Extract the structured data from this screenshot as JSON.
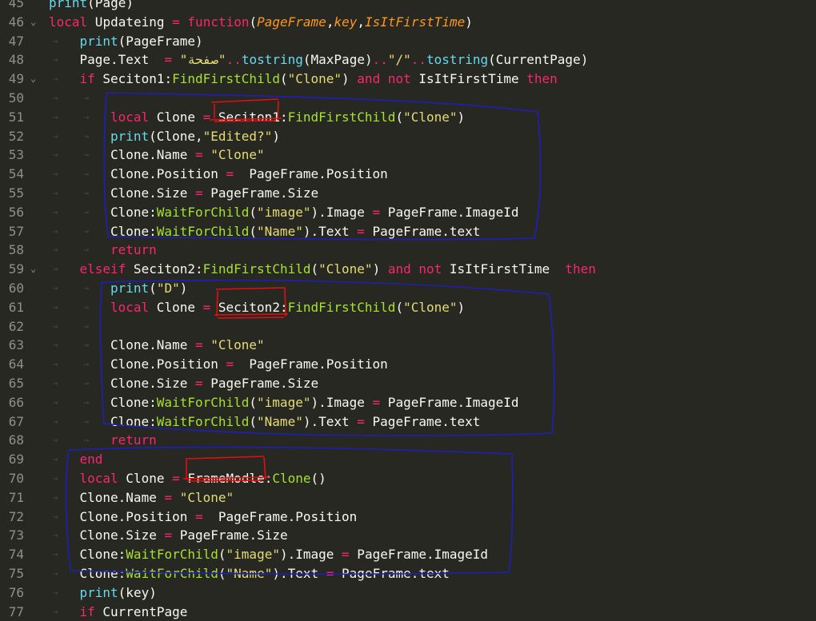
{
  "lines": [
    {
      "n": "45",
      "indent": 0,
      "fold": false,
      "tokens": [
        {
          "c": "bi",
          "t": "print"
        },
        {
          "c": "w",
          "t": "(Page)"
        }
      ]
    },
    {
      "n": "46",
      "indent": 0,
      "fold": true,
      "tokens": [
        {
          "c": "k",
          "t": "local"
        },
        {
          "c": "w",
          "t": " Updateing "
        },
        {
          "c": "k",
          "t": "="
        },
        {
          "c": "w",
          "t": " "
        },
        {
          "c": "k",
          "t": "function"
        },
        {
          "c": "w",
          "t": "("
        },
        {
          "c": "p",
          "t": "PageFrame"
        },
        {
          "c": "w",
          "t": ","
        },
        {
          "c": "p",
          "t": "key"
        },
        {
          "c": "w",
          "t": ","
        },
        {
          "c": "p",
          "t": "IsItFirstTime"
        },
        {
          "c": "w",
          "t": ")"
        }
      ]
    },
    {
      "n": "47",
      "indent": 1,
      "fold": false,
      "tokens": [
        {
          "c": "bi",
          "t": "print"
        },
        {
          "c": "w",
          "t": "(PageFrame)"
        }
      ]
    },
    {
      "n": "48",
      "indent": 1,
      "fold": false,
      "tokens": [
        {
          "c": "w",
          "t": "Page.Text  "
        },
        {
          "c": "k",
          "t": "="
        },
        {
          "c": "w",
          "t": " "
        },
        {
          "c": "s",
          "t": "\"صفحة\""
        },
        {
          "c": "k",
          "t": ".."
        },
        {
          "c": "bi",
          "t": "tostring"
        },
        {
          "c": "w",
          "t": "(MaxPage)"
        },
        {
          "c": "k",
          "t": ".."
        },
        {
          "c": "s",
          "t": "\"/\""
        },
        {
          "c": "k",
          "t": ".."
        },
        {
          "c": "bi",
          "t": "tostring"
        },
        {
          "c": "w",
          "t": "(CurrentPage)"
        }
      ]
    },
    {
      "n": "49",
      "indent": 1,
      "fold": true,
      "tokens": [
        {
          "c": "k",
          "t": "if"
        },
        {
          "c": "w",
          "t": " Seciton1:"
        },
        {
          "c": "f",
          "t": "FindFirstChild"
        },
        {
          "c": "w",
          "t": "("
        },
        {
          "c": "s",
          "t": "\"Clone\""
        },
        {
          "c": "w",
          "t": ") "
        },
        {
          "c": "k",
          "t": "and"
        },
        {
          "c": "w",
          "t": " "
        },
        {
          "c": "k",
          "t": "not"
        },
        {
          "c": "w",
          "t": " IsItFirstTime "
        },
        {
          "c": "k",
          "t": "then"
        }
      ]
    },
    {
      "n": "50",
      "indent": 2,
      "fold": false,
      "tokens": []
    },
    {
      "n": "51",
      "indent": 2,
      "fold": false,
      "tokens": [
        {
          "c": "k",
          "t": "local"
        },
        {
          "c": "w",
          "t": " Clone "
        },
        {
          "c": "k",
          "t": "="
        },
        {
          "c": "w",
          "t": " Seciton1:"
        },
        {
          "c": "f",
          "t": "FindFirstChild"
        },
        {
          "c": "w",
          "t": "("
        },
        {
          "c": "s",
          "t": "\"Clone\""
        },
        {
          "c": "w",
          "t": ")"
        }
      ]
    },
    {
      "n": "52",
      "indent": 2,
      "fold": false,
      "tokens": [
        {
          "c": "bi",
          "t": "print"
        },
        {
          "c": "w",
          "t": "(Clone,"
        },
        {
          "c": "s",
          "t": "\"Edited?\""
        },
        {
          "c": "w",
          "t": ")"
        }
      ]
    },
    {
      "n": "53",
      "indent": 2,
      "fold": false,
      "tokens": [
        {
          "c": "w",
          "t": "Clone.Name "
        },
        {
          "c": "k",
          "t": "="
        },
        {
          "c": "w",
          "t": " "
        },
        {
          "c": "s",
          "t": "\"Clone\""
        }
      ]
    },
    {
      "n": "54",
      "indent": 2,
      "fold": false,
      "tokens": [
        {
          "c": "w",
          "t": "Clone.Position "
        },
        {
          "c": "k",
          "t": "="
        },
        {
          "c": "w",
          "t": "  PageFrame.Position"
        }
      ]
    },
    {
      "n": "55",
      "indent": 2,
      "fold": false,
      "tokens": [
        {
          "c": "w",
          "t": "Clone.Size "
        },
        {
          "c": "k",
          "t": "="
        },
        {
          "c": "w",
          "t": " PageFrame.Size"
        }
      ]
    },
    {
      "n": "56",
      "indent": 2,
      "fold": false,
      "tokens": [
        {
          "c": "w",
          "t": "Clone:"
        },
        {
          "c": "f",
          "t": "WaitForChild"
        },
        {
          "c": "w",
          "t": "("
        },
        {
          "c": "s",
          "t": "\"image\""
        },
        {
          "c": "w",
          "t": ").Image "
        },
        {
          "c": "k",
          "t": "="
        },
        {
          "c": "w",
          "t": " PageFrame.ImageId"
        }
      ]
    },
    {
      "n": "57",
      "indent": 2,
      "fold": false,
      "tokens": [
        {
          "c": "w",
          "t": "Clone:"
        },
        {
          "c": "f",
          "t": "WaitForChild"
        },
        {
          "c": "w",
          "t": "("
        },
        {
          "c": "s",
          "t": "\"Name\""
        },
        {
          "c": "w",
          "t": ").Text "
        },
        {
          "c": "k",
          "t": "="
        },
        {
          "c": "w",
          "t": " PageFrame.text"
        }
      ]
    },
    {
      "n": "58",
      "indent": 2,
      "fold": false,
      "tokens": [
        {
          "c": "k",
          "t": "return"
        }
      ]
    },
    {
      "n": "59",
      "indent": 1,
      "fold": true,
      "tokens": [
        {
          "c": "k",
          "t": "elseif"
        },
        {
          "c": "w",
          "t": " Seciton2:"
        },
        {
          "c": "f",
          "t": "FindFirstChild"
        },
        {
          "c": "w",
          "t": "("
        },
        {
          "c": "s",
          "t": "\"Clone\""
        },
        {
          "c": "w",
          "t": ") "
        },
        {
          "c": "k",
          "t": "and"
        },
        {
          "c": "w",
          "t": " "
        },
        {
          "c": "k",
          "t": "not"
        },
        {
          "c": "w",
          "t": " IsItFirstTime  "
        },
        {
          "c": "k",
          "t": "then"
        }
      ]
    },
    {
      "n": "60",
      "indent": 2,
      "fold": false,
      "tokens": [
        {
          "c": "bi",
          "t": "print"
        },
        {
          "c": "w",
          "t": "("
        },
        {
          "c": "s",
          "t": "\"D\""
        },
        {
          "c": "w",
          "t": ")"
        }
      ]
    },
    {
      "n": "61",
      "indent": 2,
      "fold": false,
      "tokens": [
        {
          "c": "k",
          "t": "local"
        },
        {
          "c": "w",
          "t": " Clone "
        },
        {
          "c": "k",
          "t": "="
        },
        {
          "c": "w",
          "t": " Seciton2:"
        },
        {
          "c": "f",
          "t": "FindFirstChild"
        },
        {
          "c": "w",
          "t": "("
        },
        {
          "c": "s",
          "t": "\"Clone\""
        },
        {
          "c": "w",
          "t": ")"
        }
      ]
    },
    {
      "n": "62",
      "indent": 2,
      "fold": false,
      "tokens": []
    },
    {
      "n": "63",
      "indent": 2,
      "fold": false,
      "tokens": [
        {
          "c": "w",
          "t": "Clone.Name "
        },
        {
          "c": "k",
          "t": "="
        },
        {
          "c": "w",
          "t": " "
        },
        {
          "c": "s",
          "t": "\"Clone\""
        }
      ]
    },
    {
      "n": "64",
      "indent": 2,
      "fold": false,
      "tokens": [
        {
          "c": "w",
          "t": "Clone.Position "
        },
        {
          "c": "k",
          "t": "="
        },
        {
          "c": "w",
          "t": "  PageFrame.Position"
        }
      ]
    },
    {
      "n": "65",
      "indent": 2,
      "fold": false,
      "tokens": [
        {
          "c": "w",
          "t": "Clone.Size "
        },
        {
          "c": "k",
          "t": "="
        },
        {
          "c": "w",
          "t": " PageFrame.Size"
        }
      ]
    },
    {
      "n": "66",
      "indent": 2,
      "fold": false,
      "tokens": [
        {
          "c": "w",
          "t": "Clone:"
        },
        {
          "c": "f",
          "t": "WaitForChild"
        },
        {
          "c": "w",
          "t": "("
        },
        {
          "c": "s",
          "t": "\"image\""
        },
        {
          "c": "w",
          "t": ").Image "
        },
        {
          "c": "k",
          "t": "="
        },
        {
          "c": "w",
          "t": " PageFrame.ImageId"
        }
      ]
    },
    {
      "n": "67",
      "indent": 2,
      "fold": false,
      "tokens": [
        {
          "c": "w",
          "t": "Clone:"
        },
        {
          "c": "f",
          "t": "WaitForChild"
        },
        {
          "c": "w",
          "t": "("
        },
        {
          "c": "s",
          "t": "\"Name\""
        },
        {
          "c": "w",
          "t": ").Text "
        },
        {
          "c": "k",
          "t": "="
        },
        {
          "c": "w",
          "t": " PageFrame.text"
        }
      ]
    },
    {
      "n": "68",
      "indent": 2,
      "fold": false,
      "tokens": [
        {
          "c": "k",
          "t": "return"
        }
      ]
    },
    {
      "n": "69",
      "indent": 1,
      "fold": false,
      "tokens": [
        {
          "c": "k",
          "t": "end"
        }
      ]
    },
    {
      "n": "70",
      "indent": 1,
      "fold": false,
      "tokens": [
        {
          "c": "k",
          "t": "local"
        },
        {
          "c": "w",
          "t": " Clone "
        },
        {
          "c": "k",
          "t": "="
        },
        {
          "c": "w",
          "t": " FrameModle:"
        },
        {
          "c": "f",
          "t": "Clone"
        },
        {
          "c": "w",
          "t": "()"
        }
      ]
    },
    {
      "n": "71",
      "indent": 1,
      "fold": false,
      "tokens": [
        {
          "c": "w",
          "t": "Clone.Name "
        },
        {
          "c": "k",
          "t": "="
        },
        {
          "c": "w",
          "t": " "
        },
        {
          "c": "s",
          "t": "\"Clone\""
        }
      ]
    },
    {
      "n": "72",
      "indent": 1,
      "fold": false,
      "tokens": [
        {
          "c": "w",
          "t": "Clone.Position "
        },
        {
          "c": "k",
          "t": "="
        },
        {
          "c": "w",
          "t": "  PageFrame.Position"
        }
      ]
    },
    {
      "n": "73",
      "indent": 1,
      "fold": false,
      "tokens": [
        {
          "c": "w",
          "t": "Clone.Size "
        },
        {
          "c": "k",
          "t": "="
        },
        {
          "c": "w",
          "t": " PageFrame.Size"
        }
      ]
    },
    {
      "n": "74",
      "indent": 1,
      "fold": false,
      "tokens": [
        {
          "c": "w",
          "t": "Clone:"
        },
        {
          "c": "f",
          "t": "WaitForChild"
        },
        {
          "c": "w",
          "t": "("
        },
        {
          "c": "s",
          "t": "\"image\""
        },
        {
          "c": "w",
          "t": ").Image "
        },
        {
          "c": "k",
          "t": "="
        },
        {
          "c": "w",
          "t": " PageFrame.ImageId"
        }
      ]
    },
    {
      "n": "75",
      "indent": 1,
      "fold": false,
      "tokens": [
        {
          "c": "w",
          "t": "Clone:"
        },
        {
          "c": "f",
          "t": "WaitForChild"
        },
        {
          "c": "w",
          "t": "("
        },
        {
          "c": "s",
          "t": "\"Name\""
        },
        {
          "c": "w",
          "t": ").Text "
        },
        {
          "c": "k",
          "t": "="
        },
        {
          "c": "w",
          "t": " PageFrame.text"
        }
      ]
    },
    {
      "n": "76",
      "indent": 1,
      "fold": false,
      "tokens": [
        {
          "c": "bi",
          "t": "print"
        },
        {
          "c": "w",
          "t": "(key)"
        }
      ]
    },
    {
      "n": "77",
      "indent": 1,
      "fold": false,
      "tokens": [
        {
          "c": "k",
          "t": "if"
        },
        {
          "c": "w",
          "t": " CurrentPage"
        }
      ]
    }
  ],
  "colors": {
    "background": "#272822",
    "keyword": "#f92672",
    "function": "#a6e22e",
    "builtin": "#66d9ef",
    "string": "#e6db74",
    "parameter": "#fd971f",
    "text": "#f8f8f2",
    "line_number": "#90908a",
    "annotation_blue": "#1f1fb8",
    "annotation_red": "#e01010"
  },
  "icons": {
    "fold": "chevron-down-icon",
    "indent_guide": "arrow-right-icon"
  }
}
